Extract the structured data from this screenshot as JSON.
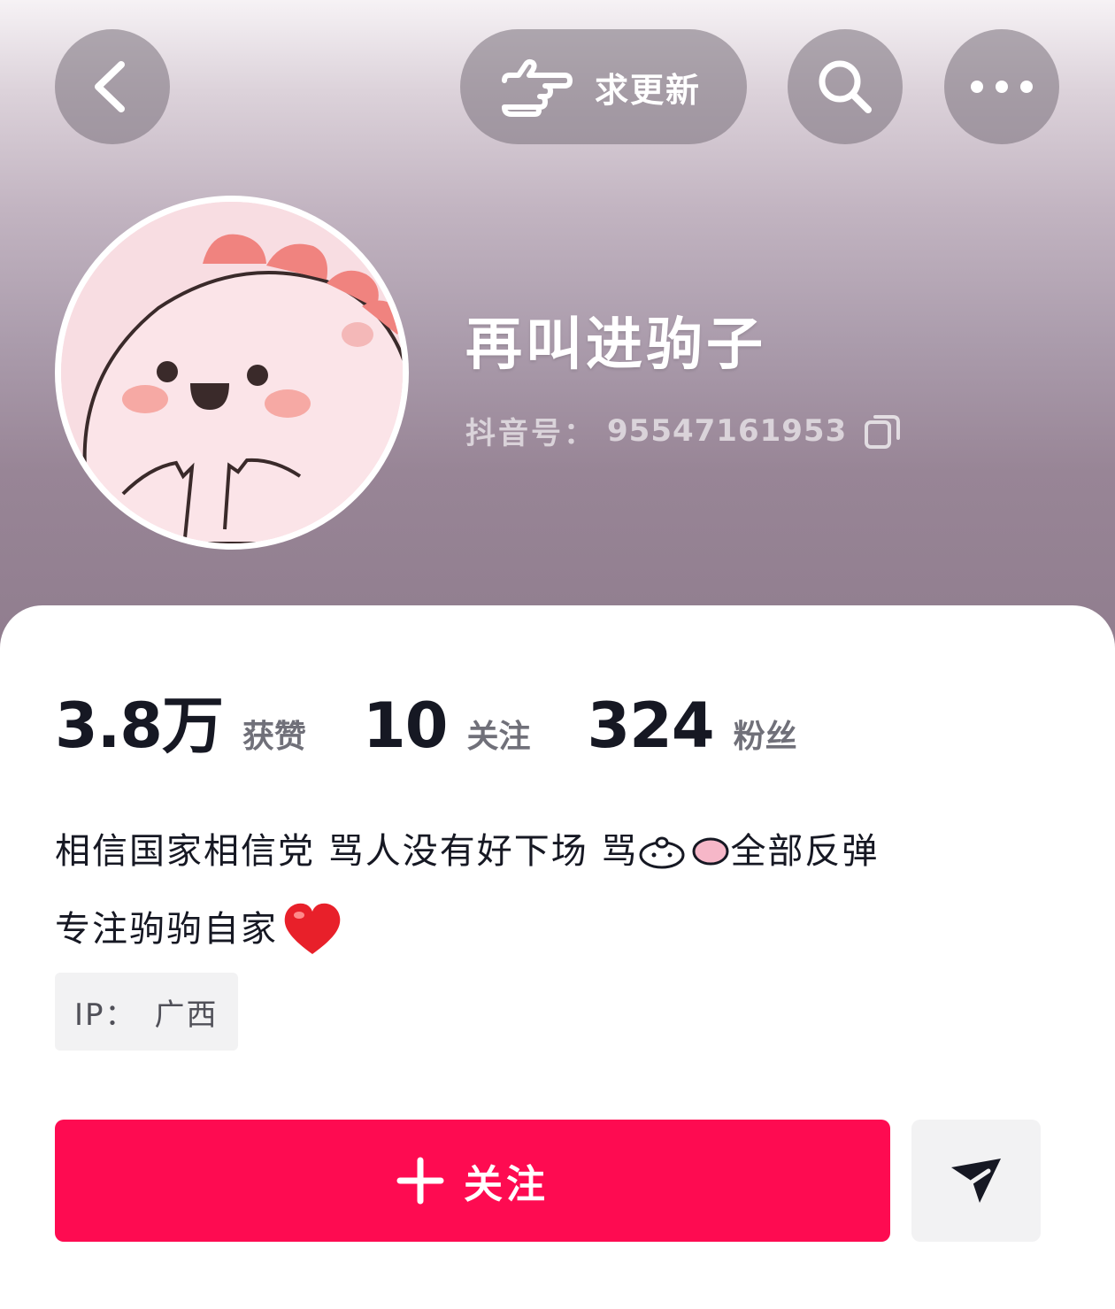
{
  "header": {
    "back_icon": "chevron-left-icon",
    "request_update_label": "求更新",
    "request_update_icon": "pointing-hand-icon",
    "search_icon": "search-icon",
    "more_icon": "more-dots-icon"
  },
  "profile": {
    "nickname": "再叫进驹子",
    "uid_label": "抖音号：",
    "uid_value": "95547161953",
    "copy_icon": "copy-icon"
  },
  "stats": [
    {
      "value": "3.8万",
      "label": "获赞"
    },
    {
      "value": "10",
      "label": "关注"
    },
    {
      "value": "324",
      "label": "粉丝"
    }
  ],
  "bio": {
    "line1_part1": "相信国家相信党  骂人没有好下场  骂",
    "line1_part2": "全部反弹",
    "line2": "专注驹驹自家"
  },
  "ip": {
    "label": "IP：",
    "value": "广西"
  },
  "actions": {
    "follow_label": "关注",
    "follow_icon": "plus-icon",
    "share_icon": "send-icon"
  },
  "colors": {
    "accent": "#fe0b51",
    "text_primary": "#161823",
    "text_secondary": "#707079",
    "tag_bg": "#f2f2f3"
  }
}
